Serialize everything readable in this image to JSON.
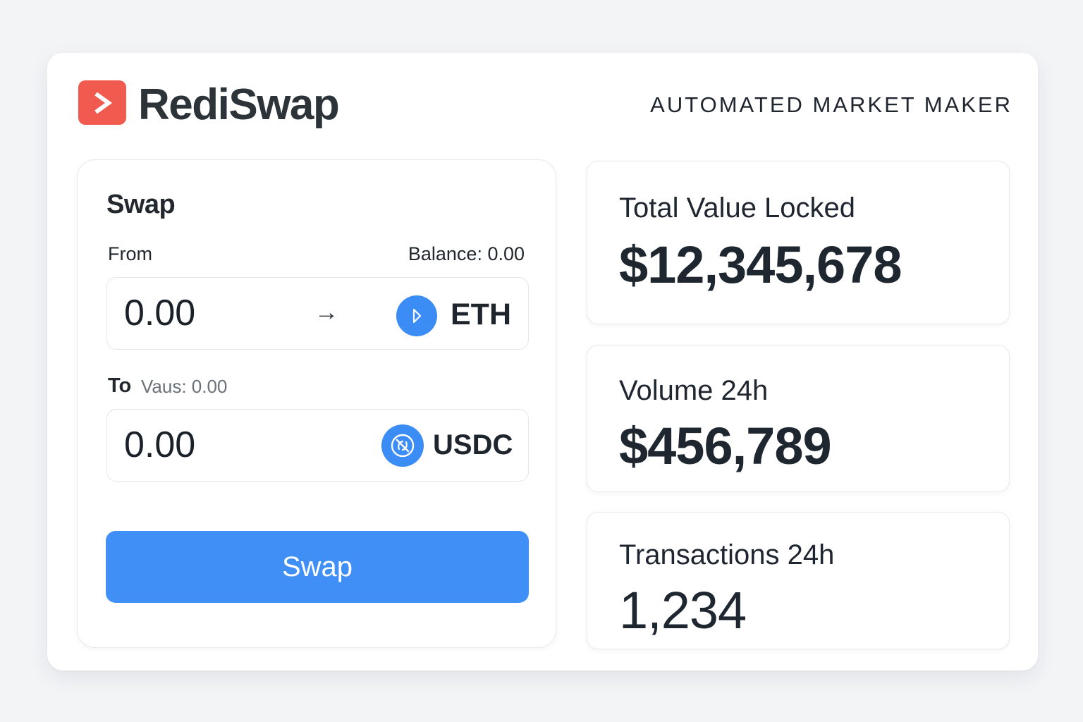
{
  "header": {
    "brand": "RediSwap",
    "tagline": "AUTOMATED MARKET MAKER",
    "logo_icon": "play-chevron-icon",
    "logo_color": "#f05a4f"
  },
  "swap": {
    "title": "Swap",
    "from": {
      "label": "From",
      "balance": "Balance: 0.00",
      "amount": "0.00",
      "token": "ETH",
      "token_icon": "eth-icon"
    },
    "to": {
      "label": "To",
      "sub_label": "Vaus: 0.00",
      "amount": "0.00",
      "token": "USDC",
      "token_icon": "usdc-icon"
    },
    "arrow": "→",
    "button_label": "Swap",
    "accent_color": "#3f8ff7"
  },
  "stats": {
    "tvl": {
      "label": "Total Value Locked",
      "value": "$12,345,678"
    },
    "volume": {
      "label": "Volume 24h",
      "value": "$456,789"
    },
    "transactions": {
      "label": "Transactions 24h",
      "value": "1,234"
    }
  }
}
